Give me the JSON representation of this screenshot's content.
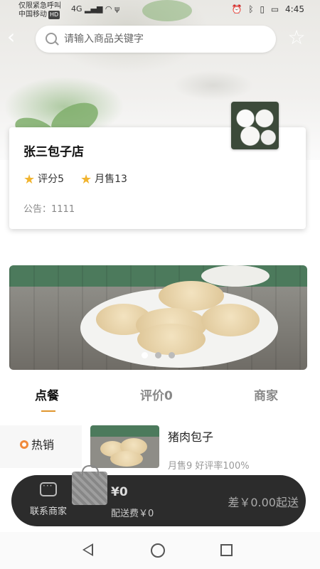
{
  "status_bar": {
    "carrier_line1": "仅限紧急呼叫",
    "carrier_line2": "中国移动",
    "hd_badge": "HD",
    "network": "4G",
    "time": "4:45"
  },
  "search": {
    "placeholder": "请输入商品关键字"
  },
  "shop": {
    "name": "张三包子店",
    "rating_label": "评分5",
    "monthly_sales_label": "月售13",
    "notice": "公告：1111"
  },
  "banner": {
    "slide_count": 3,
    "active_index": 0
  },
  "tabs": [
    {
      "label": "点餐",
      "active": true
    },
    {
      "label": "评价0",
      "active": false
    },
    {
      "label": "商家",
      "active": false
    }
  ],
  "categories": [
    {
      "label": "热销",
      "icon": "fire-icon"
    }
  ],
  "products": [
    {
      "name": "猪肉包子",
      "sub": "月售9   好评率100%"
    }
  ],
  "cart": {
    "contact_label": "联系商家",
    "price": "¥0",
    "delivery_fee": "配送费￥0",
    "minimum": "差￥0.00起送"
  },
  "colors": {
    "accent": "#e0962e",
    "star": "#f1b42f",
    "cart_bar": "#2c2c2c"
  }
}
